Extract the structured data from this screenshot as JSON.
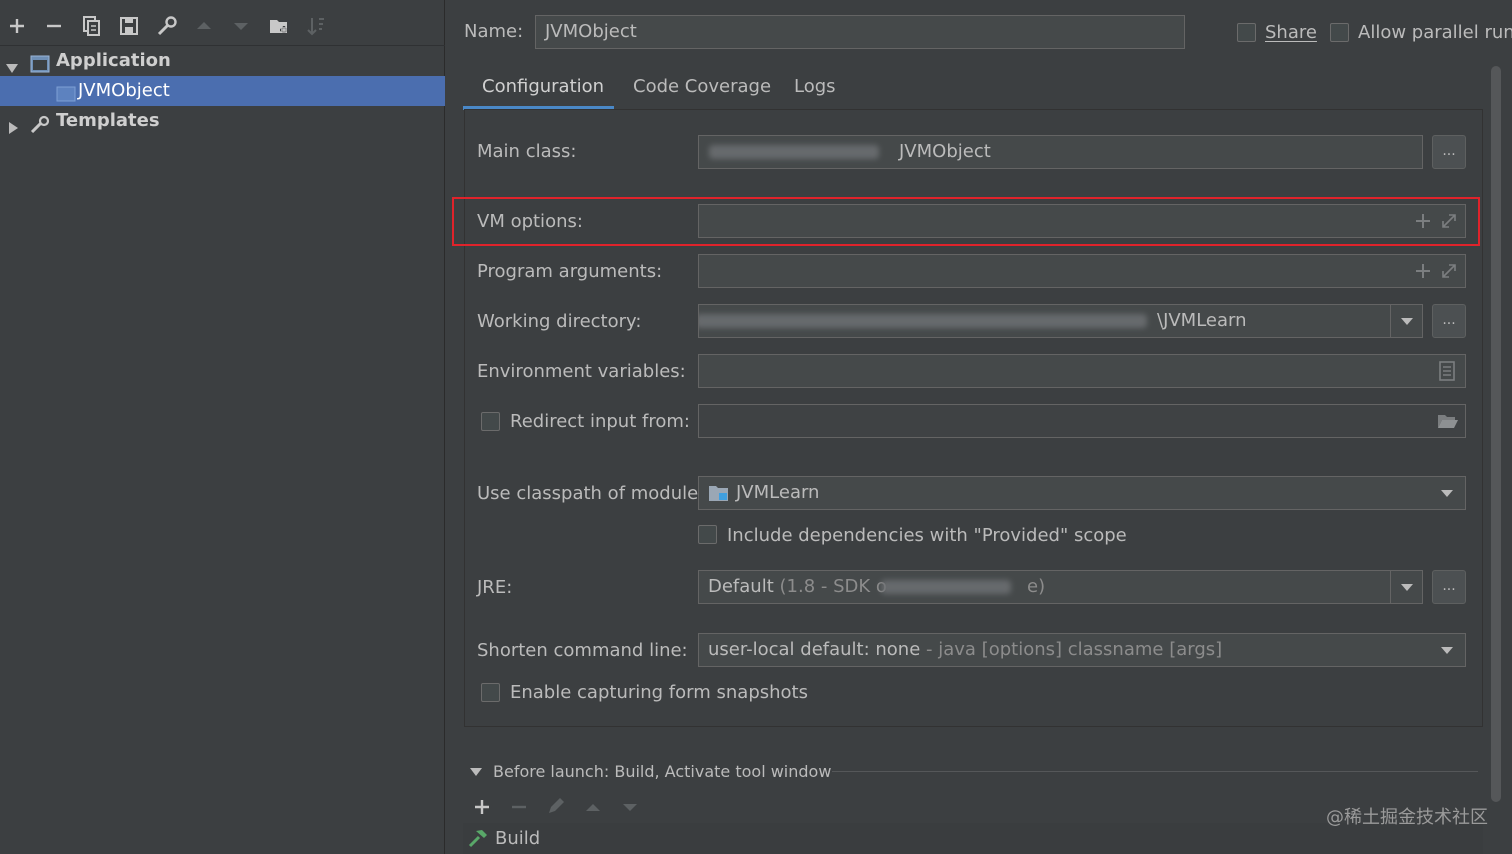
{
  "toolbar": {
    "icons": [
      "add-icon",
      "remove-icon",
      "copy-icon",
      "save-icon",
      "wrench-icon",
      "move-up-icon",
      "move-down-icon",
      "folder-add-icon",
      "sort-icon"
    ]
  },
  "tree": {
    "application_label": "Application",
    "jvmobject_label": "JVMObject",
    "templates_label": "Templates"
  },
  "header": {
    "name_label": "Name:",
    "name_value": "JVMObject",
    "share_label": "Share",
    "parallel_label": "Allow parallel run"
  },
  "tabs": [
    "Configuration",
    "Code Coverage",
    "Logs"
  ],
  "form": {
    "main_class_label": "Main class:",
    "main_class_value": "JVMObject",
    "vm_options_label": "VM options:",
    "vm_options_value": "",
    "program_args_label": "Program arguments:",
    "program_args_value": "",
    "working_dir_label": "Working directory:",
    "working_dir_value": "\\JVMLearn",
    "env_vars_label": "Environment variables:",
    "env_vars_value": "",
    "redirect_label": "Redirect input from:",
    "redirect_value": "",
    "classpath_label": "Use classpath of module:",
    "classpath_value": "JVMLearn",
    "include_deps_label": "Include dependencies with \"Provided\" scope",
    "jre_label": "JRE:",
    "jre_value_prefix": "Default",
    "jre_value_detail": "(1.8 - SDK o",
    "jre_value_suffix": "e)",
    "shorten_label": "Shorten command line:",
    "shorten_value": "user-local default: none",
    "shorten_detail": "- java [options] classname [args]",
    "snapshots_label": "Enable capturing form snapshots",
    "browse_label": "..."
  },
  "before_launch": {
    "title": "Before launch: Build, Activate tool window",
    "item_label": "Build"
  },
  "watermark": "@稀土掘金技术社区",
  "colors": {
    "background": "#3c3f41",
    "selection": "#4b6eaf",
    "field_bg": "#45494a",
    "highlight_box": "#e0232b",
    "tab_underline": "#4a88c7"
  }
}
